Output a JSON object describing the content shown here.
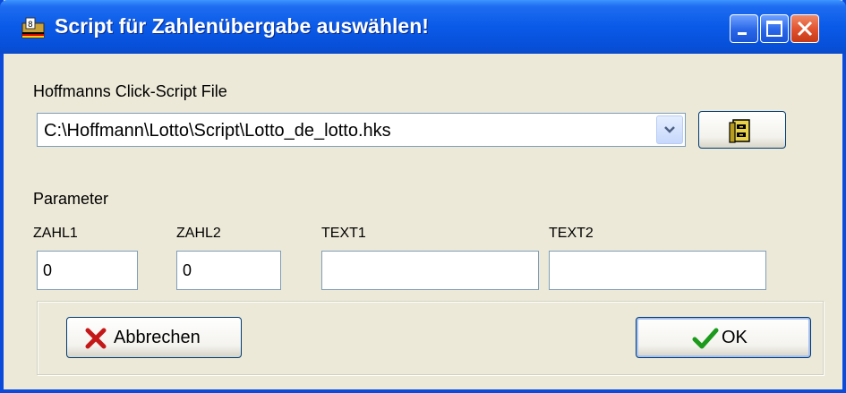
{
  "window": {
    "title": "Script für Zahlenübergabe auswählen!"
  },
  "script_file": {
    "label": "Hoffmanns Click-Script File",
    "value": "C:\\Hoffmann\\Lotto\\Script\\Lotto_de_lotto.hks"
  },
  "parameter": {
    "heading": "Parameter",
    "fields": [
      {
        "label": "ZAHL1",
        "value": "0"
      },
      {
        "label": "ZAHL2",
        "value": "0"
      },
      {
        "label": "TEXT1",
        "value": ""
      },
      {
        "label": "TEXT2",
        "value": ""
      }
    ]
  },
  "buttons": {
    "cancel": "Abbrechen",
    "ok": "OK"
  },
  "icons": {
    "title": "app-icon",
    "file": "file-cabinet-icon",
    "cancel": "red-x-icon",
    "ok": "green-check-icon"
  }
}
